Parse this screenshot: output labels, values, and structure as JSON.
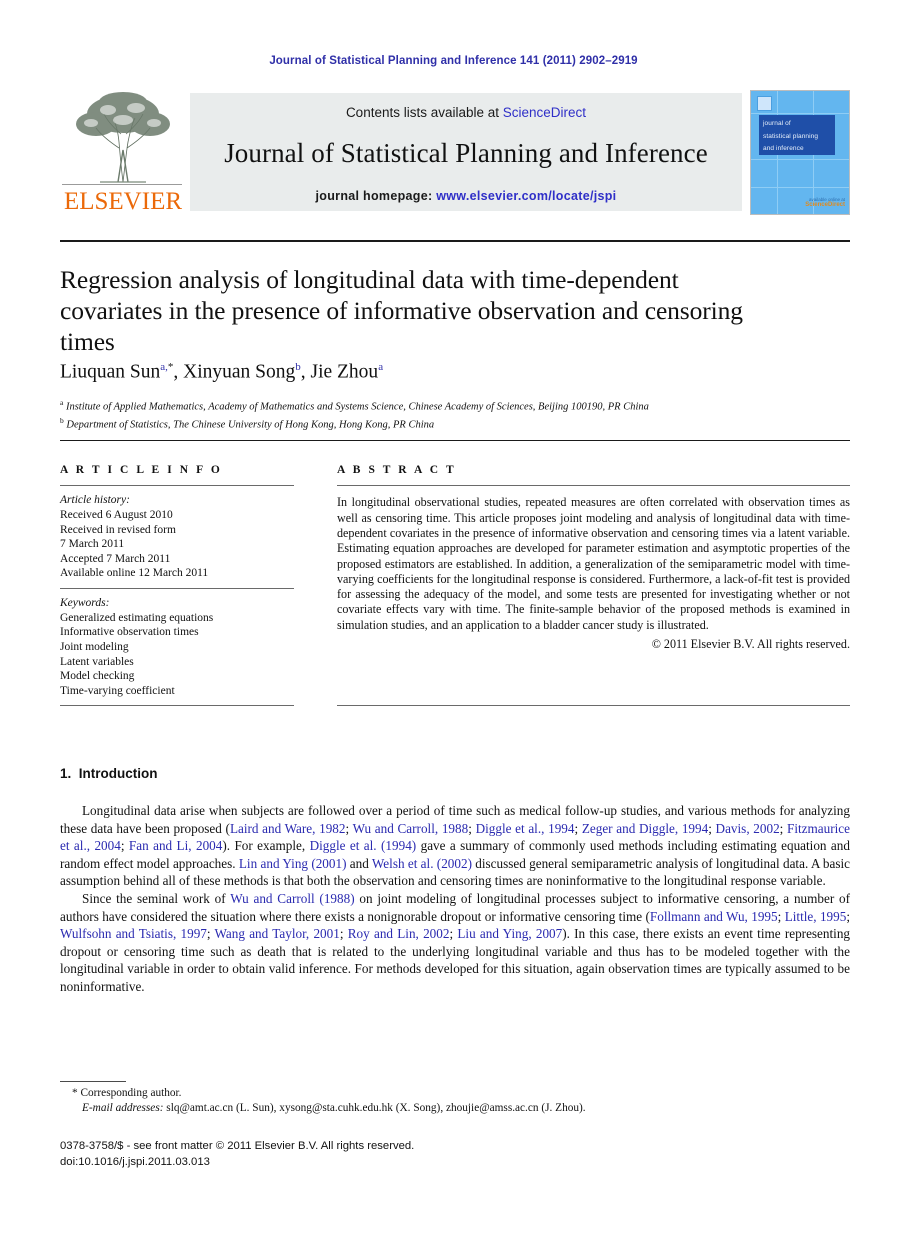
{
  "running_head": "Journal of Statistical Planning and Inference 141 (2011) 2902–2919",
  "masthead": {
    "publisher": "ELSEVIER",
    "contents_prefix": "Contents lists available at ",
    "contents_link": "ScienceDirect",
    "journal_title": "Journal of Statistical Planning and Inference",
    "homepage_prefix": "journal homepage: ",
    "homepage_url": "www.elsevier.com/locate/jspi",
    "cover": {
      "band_line1": "journal of",
      "band_line2": "statistical planning",
      "band_line3": "and inference",
      "footer_small": "available online at",
      "footer_brand": "ScienceDirect"
    },
    "colors": {
      "elsevier_orange": "#eb6909",
      "link_blue": "#2f2fc8",
      "box_gray": "#e9ecec",
      "cover_blue": "#63b6ef",
      "cover_band_blue": "#1f4fa8"
    }
  },
  "article": {
    "title": "Regression analysis of longitudinal data with time-dependent covariates in the presence of informative observation and censoring times",
    "authors_html": "Liuquan Sun <sup>a,*</sup>, Xinyuan Song <sup>b</sup>, Jie Zhou <sup>a</sup>",
    "authors_plain": "Liuquan Sun a,*, Xinyuan Song b, Jie Zhou a",
    "affiliation_a": "Institute of Applied Mathematics, Academy of Mathematics and Systems Science, Chinese Academy of Sciences, Beijing 100190, PR China",
    "affiliation_b": "Department of Statistics, The Chinese University of Hong Kong, Hong Kong, PR China"
  },
  "article_info": {
    "heading": "A R T I C L E  I N F O",
    "history_label": "Article history:",
    "history": [
      "Received 6 August 2010",
      "Received in revised form",
      "7 March 2011",
      "Accepted 7 March 2011",
      "Available online 12 March 2011"
    ],
    "keywords_label": "Keywords:",
    "keywords": [
      "Generalized estimating equations",
      "Informative observation times",
      "Joint modeling",
      "Latent variables",
      "Model checking",
      "Time-varying coefficient"
    ]
  },
  "abstract": {
    "heading": "A B S T R A C T",
    "text": "In longitudinal observational studies, repeated measures are often correlated with observation times as well as censoring time. This article proposes joint modeling and analysis of longitudinal data with time-dependent covariates in the presence of informative observation and censoring times via a latent variable. Estimating equation approaches are developed for parameter estimation and asymptotic properties of the proposed estimators are established. In addition, a generalization of the semiparametric model with time-varying coefficients for the longitudinal response is considered. Furthermore, a lack-of-fit test is provided for assessing the adequacy of the model, and some tests are presented for investigating whether or not covariate effects vary with time. The finite-sample behavior of the proposed methods is examined in simulation studies, and an application to a bladder cancer study is illustrated.",
    "copyright": "© 2011 Elsevier B.V. All rights reserved."
  },
  "introduction": {
    "number": "1.",
    "heading": "Introduction",
    "paragraph1_parts": [
      {
        "t": "Longitudinal data arise when subjects are followed over a period of time such as medical follow-up studies, and various methods for analyzing these data have been proposed (",
        "link": false
      },
      {
        "t": "Laird and Ware, 1982",
        "link": true
      },
      {
        "t": "; ",
        "link": false
      },
      {
        "t": "Wu and Carroll, 1988",
        "link": true
      },
      {
        "t": "; ",
        "link": false
      },
      {
        "t": "Diggle et al., 1994",
        "link": true
      },
      {
        "t": "; ",
        "link": false
      },
      {
        "t": "Zeger and Diggle, 1994",
        "link": true
      },
      {
        "t": "; ",
        "link": false
      },
      {
        "t": "Davis, 2002",
        "link": true
      },
      {
        "t": "; ",
        "link": false
      },
      {
        "t": "Fitzmaurice et al., 2004",
        "link": true
      },
      {
        "t": "; ",
        "link": false
      },
      {
        "t": "Fan and Li, 2004",
        "link": true
      },
      {
        "t": "). For example, ",
        "link": false
      },
      {
        "t": "Diggle et al. (1994)",
        "link": true
      },
      {
        "t": " gave a summary of commonly used methods including estimating equation and random effect model approaches. ",
        "link": false
      },
      {
        "t": "Lin and Ying (2001)",
        "link": true
      },
      {
        "t": " and ",
        "link": false
      },
      {
        "t": "Welsh et al. (2002)",
        "link": true
      },
      {
        "t": " discussed general semiparametric analysis of longitudinal data. A basic assumption behind all of these methods is that both the observation and censoring times are noninformative to the longitudinal response variable.",
        "link": false
      }
    ],
    "paragraph2_parts": [
      {
        "t": "Since the seminal work of ",
        "link": false
      },
      {
        "t": "Wu and Carroll (1988)",
        "link": true
      },
      {
        "t": " on joint modeling of longitudinal processes subject to informative censoring, a number of authors have considered the situation where there exists a nonignorable dropout or informative censoring time (",
        "link": false
      },
      {
        "t": "Follmann and Wu, 1995",
        "link": true
      },
      {
        "t": "; ",
        "link": false
      },
      {
        "t": "Little, 1995",
        "link": true
      },
      {
        "t": "; ",
        "link": false
      },
      {
        "t": "Wulfsohn and Tsiatis, 1997",
        "link": true
      },
      {
        "t": "; ",
        "link": false
      },
      {
        "t": "Wang and Taylor, 2001",
        "link": true
      },
      {
        "t": "; ",
        "link": false
      },
      {
        "t": "Roy and Lin, 2002",
        "link": true
      },
      {
        "t": "; ",
        "link": false
      },
      {
        "t": "Liu and Ying, 2007",
        "link": true
      },
      {
        "t": "). In this case, there exists an event time representing dropout or censoring time such as death that is related to the underlying longitudinal variable and thus has to be modeled together with the longitudinal variable in order to obtain valid inference. For methods developed for this situation, again observation times are typically assumed to be noninformative.",
        "link": false
      }
    ]
  },
  "footnotes": {
    "corresponding": "* Corresponding author.",
    "email_label": "E-mail addresses:",
    "emails": " slq@amt.ac.cn (L. Sun), xysong@sta.cuhk.edu.hk (X. Song), zhoujie@amss.ac.cn (J. Zhou).",
    "front_matter": "0378-3758/$ - see front matter © 2011 Elsevier B.V. All rights reserved.",
    "doi": "doi:10.1016/j.jspi.2011.03.013"
  }
}
